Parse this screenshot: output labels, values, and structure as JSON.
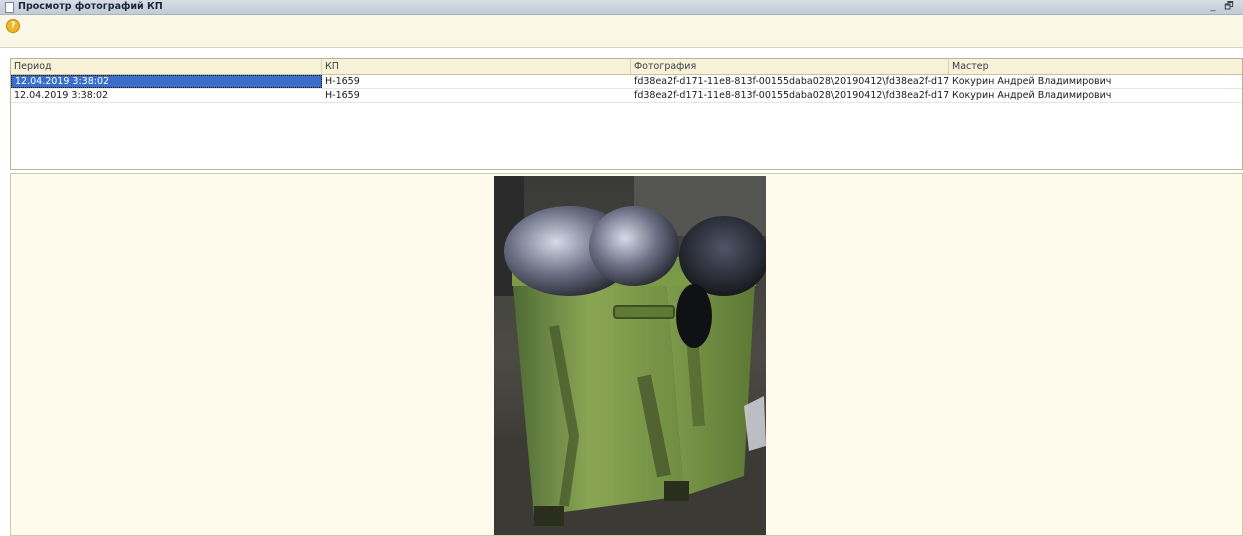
{
  "window": {
    "title": "Просмотр фотографий КП",
    "minimize_glyph": "_",
    "restore_glyph": "🗗"
  },
  "toolbar": {
    "help_icon": "help-icon",
    "help_glyph": "?"
  },
  "table": {
    "columns": [
      "Период",
      "КП",
      "Фотография",
      "Мастер"
    ],
    "rows": [
      {
        "period": "12.04.2019 3:38:02",
        "kp": "Н-1659",
        "photo": "fd38ea2f-d171-11e8-813f-00155daba028\\20190412\\fd38ea2f-d171-1...",
        "master": "Кокурин Андрей Владимирович"
      },
      {
        "period": "12.04.2019 3:38:02",
        "kp": "Н-1659",
        "photo": "fd38ea2f-d171-11e8-813f-00155daba028\\20190412\\fd38ea2f-d171-1...",
        "master": "Кокурин Андрей Владимирович"
      }
    ],
    "selected_row": 0
  },
  "colors": {
    "selection": "#3a6ec9",
    "panel_background": "#fefaec",
    "header_background": "#f7f1d8"
  }
}
